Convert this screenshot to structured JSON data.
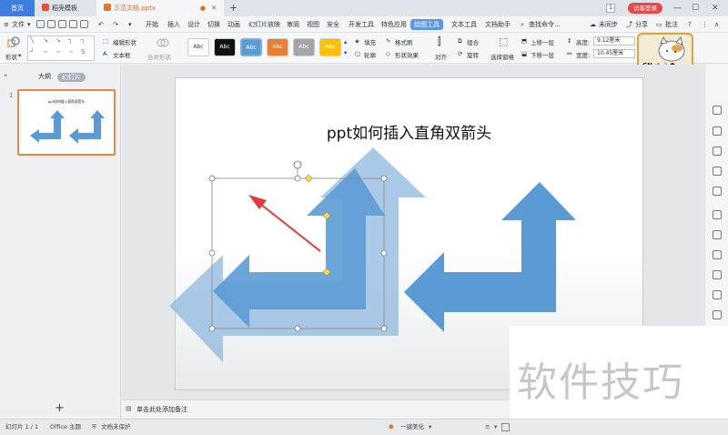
{
  "titlebar": {
    "home_tab": "首页",
    "templates_tab": "稻壳模板",
    "doc_tab": "示范文档.pptx",
    "new_tab_symbol": "+",
    "page_count_badge": "1",
    "visitor_login": "访客登录",
    "minimize": "—",
    "maximize": "☐",
    "close": "✕"
  },
  "menubar": {
    "file": "文件",
    "items": [
      "开始",
      "插入",
      "设计",
      "切换",
      "动画",
      "幻灯片放映",
      "审阅",
      "视图",
      "安全",
      "开发工具",
      "特色应用",
      "绘图工具",
      "文本工具",
      "文档助手"
    ],
    "active": "绘图工具",
    "search": "查找命令...",
    "unsynced": "未同步",
    "share": "分享",
    "comments": "批注",
    "help": "?"
  },
  "ribbon": {
    "shape": "形状",
    "edit_shape": "编辑形状",
    "textbox": "文本框",
    "merge_shapes": "合并形状",
    "swatches": [
      {
        "label": "Abc",
        "bg": "#ffffff",
        "fg": "#333333"
      },
      {
        "label": "Abc",
        "bg": "#111111",
        "fg": "#ffffff"
      },
      {
        "label": "Abc",
        "bg": "#5b9bd5",
        "fg": "#ffffff"
      },
      {
        "label": "Abc",
        "bg": "#ed7d31",
        "fg": "#ffffff"
      },
      {
        "label": "Abc",
        "bg": "#a5a5a5",
        "fg": "#ffffff"
      },
      {
        "label": "Abc",
        "bg": "#ffc000",
        "fg": "#ffffff"
      }
    ],
    "fill": "填充",
    "format_painter": "格式刷",
    "outline": "轮廓",
    "shape_effect": "形状效果",
    "align": "对齐",
    "group": "组合",
    "rotate": "旋转",
    "selection_pane": "选择窗格",
    "bring_forward": "上移一层",
    "send_backward": "下移一层",
    "height_label": "高度:",
    "height_value": "9.12厘米",
    "width_label": "宽度:",
    "width_value": "10.45厘米"
  },
  "leftpane": {
    "outline_tab": "大纲",
    "slides_tab": "幻灯片",
    "slide_number": "1",
    "thumb_title": "ppt如何插入直角双箭头",
    "add_slide": "+"
  },
  "slide": {
    "title": "ppt如何插入直角双箭头"
  },
  "notes": {
    "placeholder": "单击此处添加备注"
  },
  "statusbar": {
    "slide_info": "幻灯片 1 / 1",
    "theme": "Office 主题",
    "protection": "文档未保护",
    "beautify": "一键美化"
  },
  "mascot": {
    "text": "CN ·ˢ ☽ ☗"
  },
  "watermark": {
    "text": "软件技巧"
  },
  "colors": {
    "accent_blue": "#3e7ee0",
    "arrow_blue": "#5b9bd5",
    "arrow_blue_light": "#8fb8e0",
    "pointer_red": "#e03b3b",
    "doc_tab_orange": "#d96b1f"
  }
}
